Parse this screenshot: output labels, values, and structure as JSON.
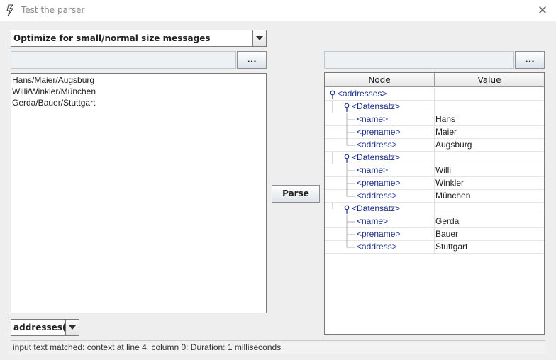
{
  "window": {
    "title": "Test the parser"
  },
  "mode_combo": {
    "selected": "Optimize for small/normal size messages"
  },
  "left_browse_label": "...",
  "right_browse_label": "...",
  "input_text": [
    "Hans/Maier/Augsburg",
    "Willi/Winkler/München",
    "Gerda/Bauer/Stuttgart"
  ],
  "parse_button_label": "Parse",
  "rule_combo": {
    "selected": "addresses()"
  },
  "tree": {
    "columns": [
      "Node",
      "Value"
    ],
    "rows": [
      {
        "node": "<addresses>",
        "value": "",
        "level": 0,
        "expandable": true
      },
      {
        "node": "<Datensatz>",
        "value": "",
        "level": 1,
        "expandable": true
      },
      {
        "node": "<name>",
        "value": "Hans",
        "level": 2,
        "expandable": false
      },
      {
        "node": "<prename>",
        "value": "Maier",
        "level": 2,
        "expandable": false
      },
      {
        "node": "<address>",
        "value": "Augsburg",
        "level": 2,
        "expandable": false
      },
      {
        "node": "<Datensatz>",
        "value": "",
        "level": 1,
        "expandable": true
      },
      {
        "node": "<name>",
        "value": "Willi",
        "level": 2,
        "expandable": false
      },
      {
        "node": "<prename>",
        "value": "Winkler",
        "level": 2,
        "expandable": false
      },
      {
        "node": "<address>",
        "value": "München",
        "level": 2,
        "expandable": false
      },
      {
        "node": "<Datensatz>",
        "value": "",
        "level": 1,
        "expandable": true
      },
      {
        "node": "<name>",
        "value": "Gerda",
        "level": 2,
        "expandable": false
      },
      {
        "node": "<prename>",
        "value": "Bauer",
        "level": 2,
        "expandable": false
      },
      {
        "node": "<address>",
        "value": "Stuttgart",
        "level": 2,
        "expandable": false
      }
    ]
  },
  "status": "input text matched: context at line 4, column 0:  Duration: 1 milliseconds",
  "colors": {
    "node_text": "#1d2f8a",
    "background": "#eeeeee"
  }
}
